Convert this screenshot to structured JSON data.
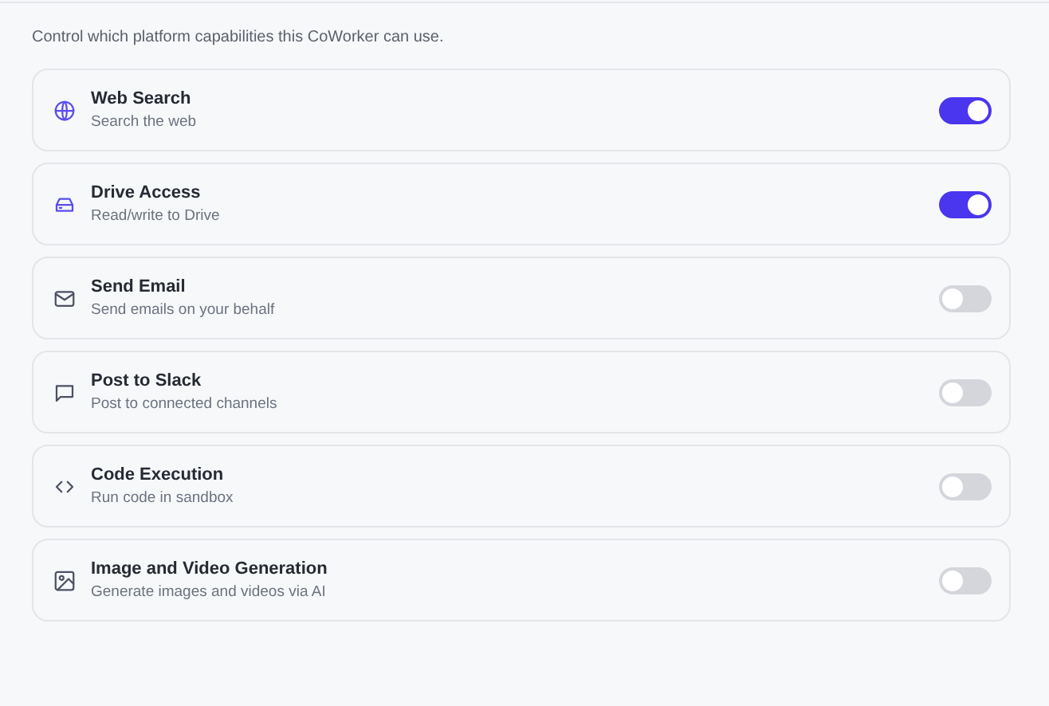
{
  "description": "Control which platform capabilities this CoWorker can use.",
  "capabilities": [
    {
      "name": "Web Search",
      "detail": "Search the web",
      "on": true
    },
    {
      "name": "Drive Access",
      "detail": "Read/write to Drive",
      "on": true
    },
    {
      "name": "Send Email",
      "detail": "Send emails on your behalf",
      "on": false
    },
    {
      "name": "Post to Slack",
      "detail": "Post to connected channels",
      "on": false
    },
    {
      "name": "Code Execution",
      "detail": "Run code in sandbox",
      "on": false
    },
    {
      "name": "Image and Video Generation",
      "detail": "Generate images and videos via AI",
      "on": false
    }
  ]
}
